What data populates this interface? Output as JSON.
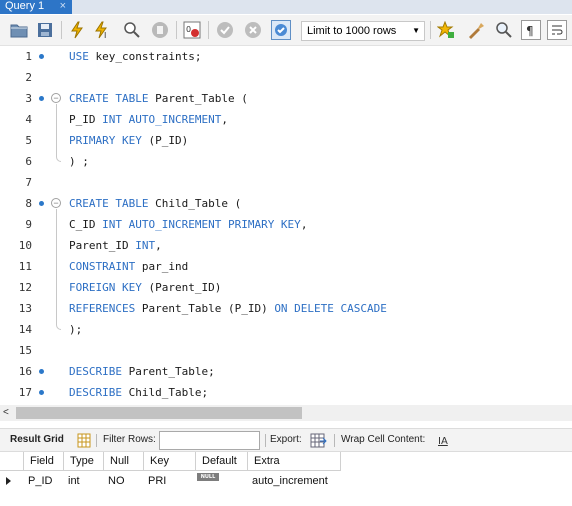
{
  "tab": {
    "label": "Query 1",
    "close": "×"
  },
  "toolbar": {
    "limit_value": "Limit to 1000 rows",
    "icons": [
      "open-folder-icon",
      "save-icon",
      "execute-icon",
      "execute-current-icon",
      "explain-icon",
      "stop-icon",
      "toggle-error-icon",
      "commit-icon",
      "rollback-icon",
      "autocommit-icon",
      "bookmark-icon",
      "beautify-icon",
      "find-icon",
      "invisible-chars-icon",
      "wrap-icon"
    ]
  },
  "editor": {
    "lines": [
      {
        "n": "1",
        "tokens": [
          [
            "kw",
            "USE"
          ],
          [
            "t",
            " key_constraints;"
          ]
        ]
      },
      {
        "n": "2",
        "tokens": []
      },
      {
        "n": "3",
        "tokens": [
          [
            "kw",
            "CREATE TABLE"
          ],
          [
            "t",
            " Parent_Table ("
          ]
        ]
      },
      {
        "n": "4",
        "tokens": [
          [
            "t",
            "P_ID "
          ],
          [
            "kw",
            "INT AUTO_INCREMENT"
          ],
          [
            "t",
            ","
          ]
        ]
      },
      {
        "n": "5",
        "tokens": [
          [
            "kw",
            "PRIMARY KEY"
          ],
          [
            "t",
            " (P_ID)"
          ]
        ]
      },
      {
        "n": "6",
        "tokens": [
          [
            "t",
            ") ;"
          ]
        ]
      },
      {
        "n": "7",
        "tokens": []
      },
      {
        "n": "8",
        "tokens": [
          [
            "kw",
            "CREATE TABLE"
          ],
          [
            "t",
            " Child_Table ("
          ]
        ]
      },
      {
        "n": "9",
        "tokens": [
          [
            "t",
            "C_ID "
          ],
          [
            "kw",
            "INT AUTO_INCREMENT PRIMARY KEY"
          ],
          [
            "t",
            ","
          ]
        ]
      },
      {
        "n": "10",
        "tokens": [
          [
            "t",
            "Parent_ID "
          ],
          [
            "kw",
            "INT"
          ],
          [
            "t",
            ","
          ]
        ]
      },
      {
        "n": "11",
        "tokens": [
          [
            "kw",
            "CONSTRAINT"
          ],
          [
            "t",
            " par_ind"
          ]
        ]
      },
      {
        "n": "12",
        "tokens": [
          [
            "kw",
            "FOREIGN KEY"
          ],
          [
            "t",
            " (Parent_ID)"
          ]
        ]
      },
      {
        "n": "13",
        "tokens": [
          [
            "kw",
            "REFERENCES"
          ],
          [
            "t",
            " Parent_Table (P_ID) "
          ],
          [
            "kw",
            "ON DELETE CASCADE"
          ]
        ]
      },
      {
        "n": "14",
        "tokens": [
          [
            "t",
            ");"
          ]
        ]
      },
      {
        "n": "15",
        "tokens": []
      },
      {
        "n": "16",
        "tokens": [
          [
            "kw",
            "DESCRIBE"
          ],
          [
            "t",
            " Parent_Table;"
          ]
        ]
      },
      {
        "n": "17",
        "tokens": [
          [
            "kw",
            "DESCRIBE"
          ],
          [
            "t",
            " Child_Table;"
          ]
        ]
      }
    ],
    "keyword_color": "#2d6fc4",
    "marker_color": "#2b78c9"
  },
  "result_bar": {
    "result_grid_label": "Result Grid",
    "filter_rows_label": "Filter Rows:",
    "filter_value": "",
    "export_label": "Export:",
    "wrap_label": "Wrap Cell Content:"
  },
  "grid": {
    "columns": [
      "Field",
      "Type",
      "Null",
      "Key",
      "Default",
      "Extra"
    ],
    "rows": [
      {
        "Field": "P_ID",
        "Type": "int",
        "Null": "NO",
        "Key": "PRI",
        "Default": "NULL",
        "Extra": "auto_increment"
      }
    ]
  }
}
